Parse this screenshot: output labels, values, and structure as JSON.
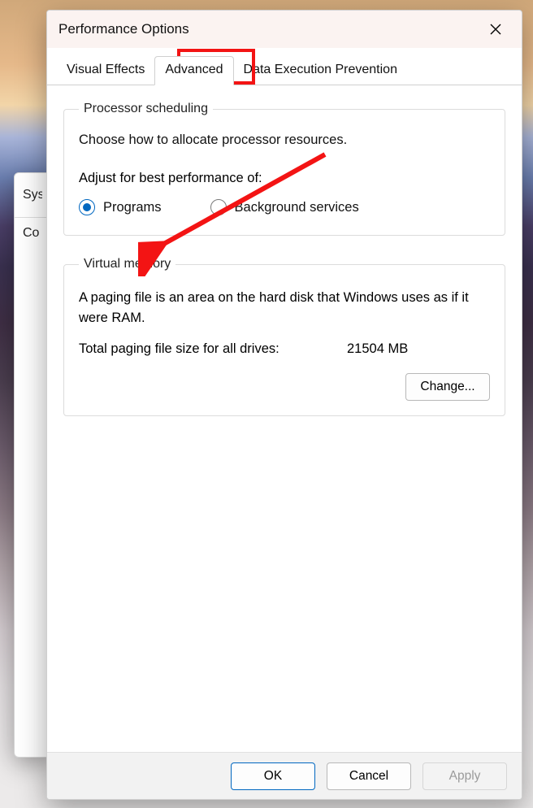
{
  "bgwin": {
    "line1": "Sys",
    "line2": "Co"
  },
  "dialog": {
    "title": "Performance Options",
    "tabs": [
      {
        "label": "Visual Effects",
        "active": false
      },
      {
        "label": "Advanced",
        "active": true
      },
      {
        "label": "Data Execution Prevention",
        "active": false
      }
    ],
    "proc": {
      "legend": "Processor scheduling",
      "desc": "Choose how to allocate processor resources.",
      "subhead": "Adjust for best performance of:",
      "options": [
        {
          "label": "Programs",
          "checked": true
        },
        {
          "label": "Background services",
          "checked": false
        }
      ]
    },
    "vm": {
      "legend": "Virtual memory",
      "desc": "A paging file is an area on the hard disk that Windows uses as if it were RAM.",
      "total_label": "Total paging file size for all drives:",
      "total_value": "21504 MB",
      "change_label": "Change..."
    },
    "footer": {
      "ok": "OK",
      "cancel": "Cancel",
      "apply": "Apply"
    }
  }
}
